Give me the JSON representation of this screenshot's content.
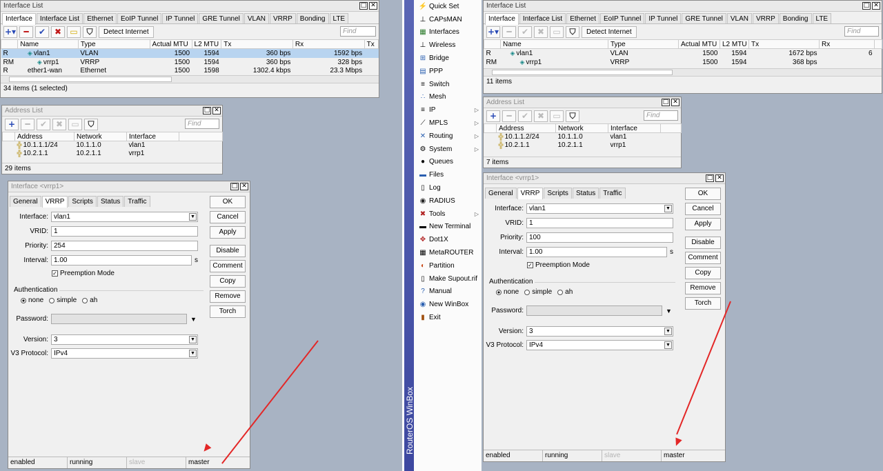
{
  "left": {
    "interface_list": {
      "title": "Interface List",
      "tabs": [
        "Interface",
        "Interface List",
        "Ethernet",
        "EoIP Tunnel",
        "IP Tunnel",
        "GRE Tunnel",
        "VLAN",
        "VRRP",
        "Bonding",
        "LTE"
      ],
      "detect_label": "Detect Internet",
      "find_placeholder": "Find",
      "columns": [
        "",
        "Name",
        "Type",
        "Actual MTU",
        "L2 MTU",
        "Tx",
        "Rx",
        "Tx"
      ],
      "rows": [
        {
          "flag": "R",
          "name": "vlan1",
          "type": "VLAN",
          "mtu": "1500",
          "l2": "1594",
          "tx": "360 bps",
          "rx": "1592 bps"
        },
        {
          "flag": "RM",
          "name": "vrrp1",
          "type": "VRRP",
          "mtu": "1500",
          "l2": "1594",
          "tx": "360 bps",
          "rx": "328 bps"
        }
      ],
      "partial_row": {
        "flag": "R",
        "name": "ether1-wan",
        "type": "Ethernet",
        "mtu": "1500",
        "l2": "1598",
        "tx": "1302.4 kbps",
        "rx": "23.3 Mbps"
      },
      "status": "34 items (1 selected)"
    },
    "address_list": {
      "title": "Address List",
      "find_placeholder": "Find",
      "columns": [
        "Address",
        "Network",
        "Interface"
      ],
      "rows": [
        {
          "address": "10.1.1.1/24",
          "network": "10.1.1.0",
          "interface": "vlan1"
        },
        {
          "address": "10.2.1.1",
          "network": "10.2.1.1",
          "interface": "vrrp1"
        }
      ],
      "status": "29 items"
    },
    "vrrp": {
      "title": "Interface <vrrp1>",
      "tabs": [
        "General",
        "VRRP",
        "Scripts",
        "Status",
        "Traffic"
      ],
      "interface_label": "Interface:",
      "interface_value": "vlan1",
      "vrid_label": "VRID:",
      "vrid_value": "1",
      "priority_label": "Priority:",
      "priority_value": "254",
      "interval_label": "Interval:",
      "interval_value": "1.00",
      "interval_unit": "s",
      "preemption_label": "Preemption Mode",
      "auth_label": "Authentication",
      "auth_none": "none",
      "auth_simple": "simple",
      "auth_ah": "ah",
      "password_label": "Password:",
      "version_label": "Version:",
      "version_value": "3",
      "v3_label": "V3 Protocol:",
      "v3_value": "IPv4",
      "buttons": [
        "OK",
        "Cancel",
        "Apply",
        "Disable",
        "Comment",
        "Copy",
        "Remove",
        "Torch"
      ],
      "status": [
        "enabled",
        "running",
        "slave",
        "master"
      ]
    }
  },
  "menu": {
    "brand": "RouterOS WinBox",
    "items": [
      {
        "label": "Quick Set",
        "icon": "quick-set-icon",
        "sub": false
      },
      {
        "label": "CAPsMAN",
        "icon": "capsman-icon",
        "sub": false
      },
      {
        "label": "Interfaces",
        "icon": "interfaces-icon",
        "sub": false
      },
      {
        "label": "Wireless",
        "icon": "wireless-icon",
        "sub": false
      },
      {
        "label": "Bridge",
        "icon": "bridge-icon",
        "sub": false
      },
      {
        "label": "PPP",
        "icon": "ppp-icon",
        "sub": false
      },
      {
        "label": "Switch",
        "icon": "switch-icon",
        "sub": false
      },
      {
        "label": "Mesh",
        "icon": "mesh-icon",
        "sub": false
      },
      {
        "label": "IP",
        "icon": "ip-icon",
        "sub": true
      },
      {
        "label": "MPLS",
        "icon": "mpls-icon",
        "sub": true
      },
      {
        "label": "Routing",
        "icon": "routing-icon",
        "sub": true
      },
      {
        "label": "System",
        "icon": "system-icon",
        "sub": true
      },
      {
        "label": "Queues",
        "icon": "queues-icon",
        "sub": false
      },
      {
        "label": "Files",
        "icon": "files-icon",
        "sub": false
      },
      {
        "label": "Log",
        "icon": "log-icon",
        "sub": false
      },
      {
        "label": "RADIUS",
        "icon": "radius-icon",
        "sub": false
      },
      {
        "label": "Tools",
        "icon": "tools-icon",
        "sub": true
      },
      {
        "label": "New Terminal",
        "icon": "terminal-icon",
        "sub": false
      },
      {
        "label": "Dot1X",
        "icon": "dot1x-icon",
        "sub": false
      },
      {
        "label": "MetaROUTER",
        "icon": "metarouter-icon",
        "sub": false
      },
      {
        "label": "Partition",
        "icon": "partition-icon",
        "sub": false
      },
      {
        "label": "Make Supout.rif",
        "icon": "supout-icon",
        "sub": false
      },
      {
        "label": "Manual",
        "icon": "manual-icon",
        "sub": false
      },
      {
        "label": "New WinBox",
        "icon": "winbox-icon",
        "sub": false
      },
      {
        "label": "Exit",
        "icon": "exit-icon",
        "sub": false
      }
    ]
  },
  "right": {
    "interface_list": {
      "title": "Interface List",
      "tabs": [
        "Interface",
        "Interface List",
        "Ethernet",
        "EoIP Tunnel",
        "IP Tunnel",
        "GRE Tunnel",
        "VLAN",
        "VRRP",
        "Bonding",
        "LTE"
      ],
      "detect_label": "Detect Internet",
      "find_placeholder": "Find",
      "columns": [
        "",
        "Name",
        "Type",
        "Actual MTU",
        "L2 MTU",
        "Tx",
        "Rx"
      ],
      "rows": [
        {
          "flag": "R",
          "name": "vlan1",
          "type": "VLAN",
          "mtu": "1500",
          "l2": "1594",
          "tx": "1672 bps",
          "rx": "6"
        },
        {
          "flag": "RM",
          "name": "vrrp1",
          "type": "VRRP",
          "mtu": "1500",
          "l2": "1594",
          "tx": "368 bps",
          "rx": ""
        }
      ],
      "status": "11 items"
    },
    "address_list": {
      "title": "Address List",
      "find_placeholder": "Find",
      "columns": [
        "Address",
        "Network",
        "Interface"
      ],
      "rows": [
        {
          "address": "10.1.1.2/24",
          "network": "10.1.1.0",
          "interface": "vlan1"
        },
        {
          "address": "10.2.1.1",
          "network": "10.2.1.1",
          "interface": "vrrp1"
        }
      ],
      "status": "7 items"
    },
    "vrrp": {
      "title": "Interface <vrrp1>",
      "tabs": [
        "General",
        "VRRP",
        "Scripts",
        "Status",
        "Traffic"
      ],
      "interface_label": "Interface:",
      "interface_value": "vlan1",
      "vrid_label": "VRID:",
      "vrid_value": "1",
      "priority_label": "Priority:",
      "priority_value": "100",
      "interval_label": "Interval:",
      "interval_value": "1.00",
      "interval_unit": "s",
      "preemption_label": "Preemption Mode",
      "auth_label": "Authentication",
      "auth_none": "none",
      "auth_simple": "simple",
      "auth_ah": "ah",
      "password_label": "Password:",
      "version_label": "Version:",
      "version_value": "3",
      "v3_label": "V3 Protocol:",
      "v3_value": "IPv4",
      "buttons": [
        "OK",
        "Cancel",
        "Apply",
        "Disable",
        "Comment",
        "Copy",
        "Remove",
        "Torch"
      ],
      "status": [
        "enabled",
        "running",
        "slave",
        "master"
      ]
    }
  },
  "colors": {
    "accent": "#2748b5",
    "selection": "#b8d4f0",
    "arrow": "#e32727",
    "menu_strip": "#4651a8"
  }
}
